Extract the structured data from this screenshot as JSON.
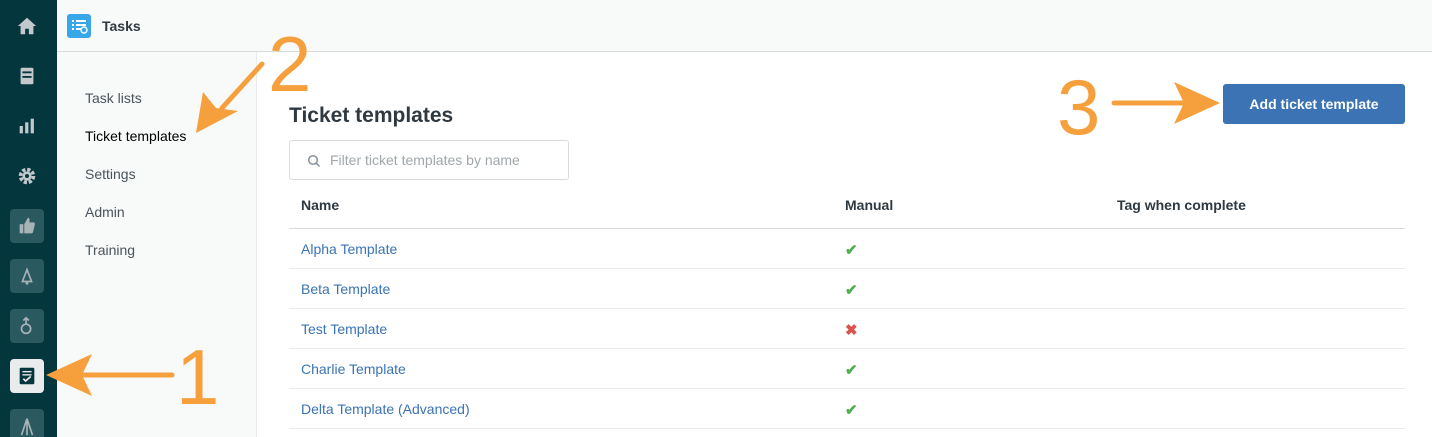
{
  "header": {
    "title": "Tasks"
  },
  "rail": {
    "items": [
      {
        "icon": "home-icon"
      },
      {
        "icon": "inbox-icon"
      },
      {
        "icon": "reports-icon"
      },
      {
        "icon": "gear-icon"
      },
      {
        "icon": "thumbs-up-icon"
      },
      {
        "icon": "bell-icon"
      },
      {
        "icon": "flow-icon"
      },
      {
        "icon": "tasks-icon"
      },
      {
        "icon": "tripod-icon"
      }
    ]
  },
  "subnav": {
    "items": [
      {
        "label": "Task lists"
      },
      {
        "label": "Ticket templates"
      },
      {
        "label": "Settings"
      },
      {
        "label": "Admin"
      },
      {
        "label": "Training"
      }
    ]
  },
  "main": {
    "title": "Ticket templates",
    "add_button": "Add ticket template",
    "search_placeholder": "Filter ticket templates by name",
    "columns": [
      "Name",
      "Manual",
      "Tag when complete"
    ],
    "rows": [
      {
        "name": "Alpha Template",
        "manual": "✔"
      },
      {
        "name": "Beta Template",
        "manual": "✔"
      },
      {
        "name": "Test Template",
        "manual": "✖"
      },
      {
        "name": "Charlie Template",
        "manual": "✔"
      },
      {
        "name": "Delta Template (Advanced)",
        "manual": "✔"
      }
    ]
  },
  "annotations": {
    "one": "1",
    "two": "2",
    "three": "3",
    "color": "#f5a03c"
  },
  "colors": {
    "rail": "#03363d",
    "primary": "#3b73b4",
    "check": "#4caf50",
    "cross": "#d9534f"
  }
}
